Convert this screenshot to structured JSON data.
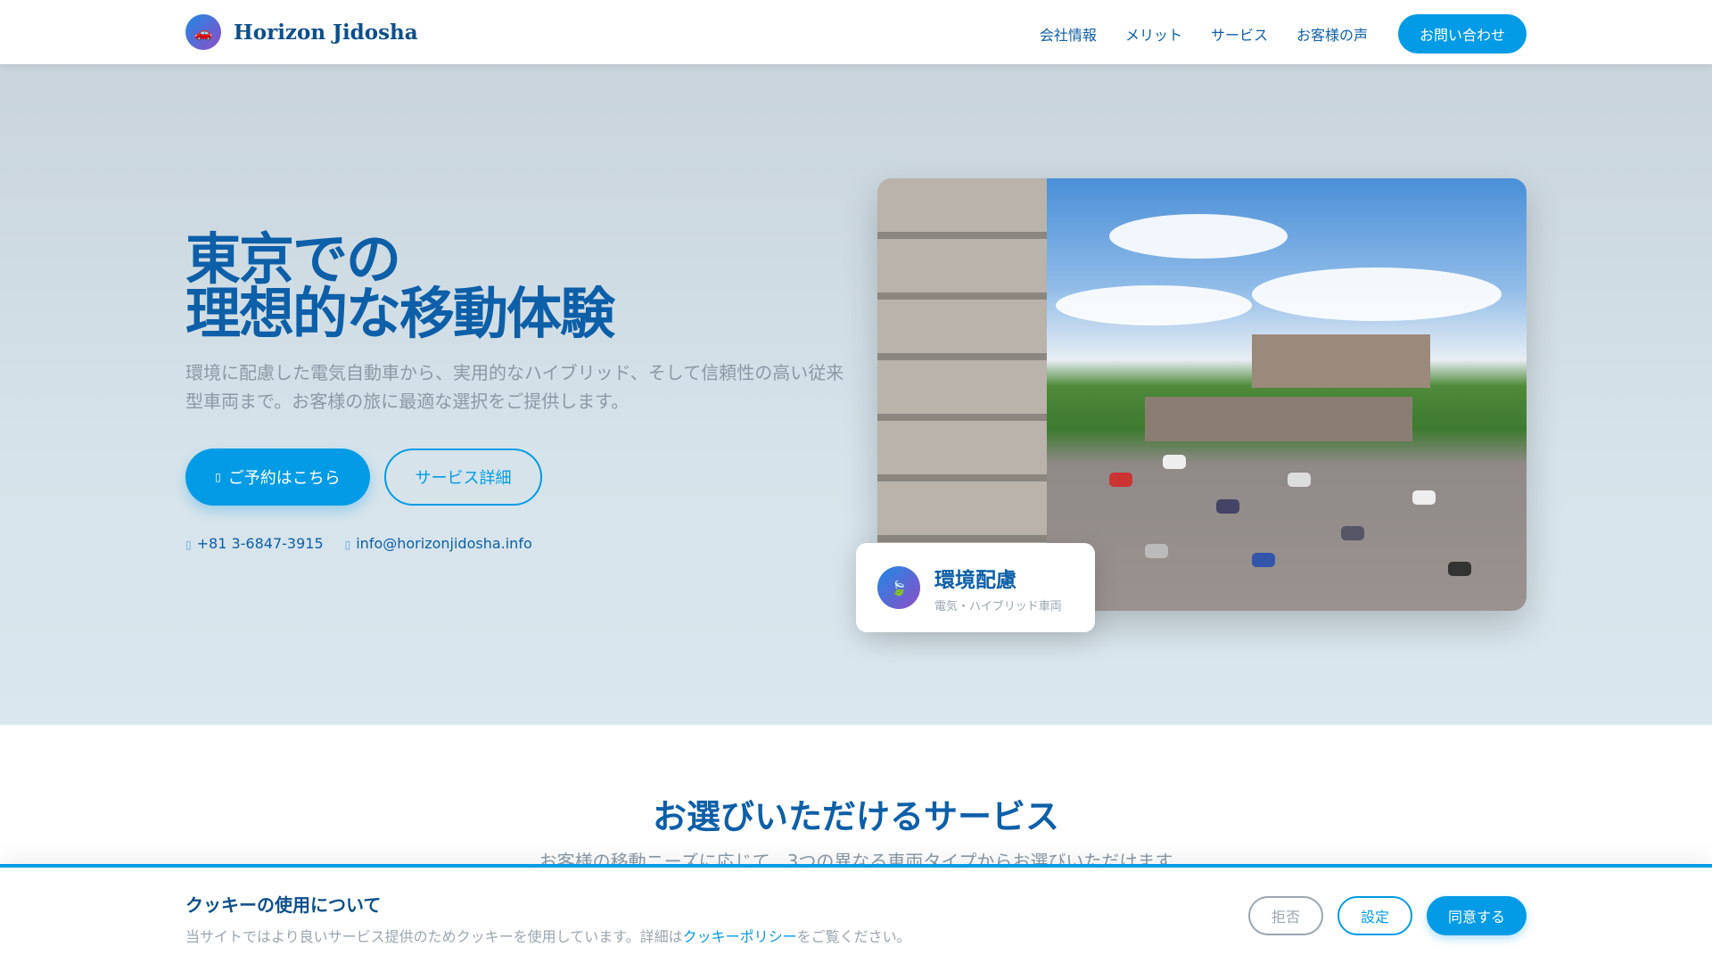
{
  "header": {
    "brand": "Horizon Jidosha",
    "nav": [
      "会社情報",
      "メリット",
      "サービス",
      "お客様の声"
    ],
    "contact_button": "お問い合わせ",
    "icon": "car-icon"
  },
  "hero": {
    "title_line1": "東京での",
    "title_line2": "理想的な移動体験",
    "lead": "環境に配慮した電気自動車から、実用的なハイブリッド、そして信頼性の高い従来型車両まで。お客様の旅に最適な選択をご提供します。",
    "primary_button": "ご予約はこちら",
    "secondary_button": "サービス詳細",
    "phone": "+81 3-6847-3915",
    "email": "info@horizonjidosha.info",
    "card": {
      "title": "環境配慮",
      "subtitle": "電気・ハイブリッド車両",
      "icon": "leaf-icon"
    }
  },
  "services": {
    "title": "お選びいただけるサービス",
    "subtitle": "お客様の移動ニーズに応じて、3つの異なる車両タイプからお選びいただけます"
  },
  "cookie": {
    "title": "クッキーの使用について",
    "text_before": "当サイトではより良いサービス提供のためクッキーを使用しています。詳細は",
    "link": "クッキーポリシー",
    "text_after": "をご覧ください。",
    "reject": "拒否",
    "settings": "設定",
    "accept": "同意する"
  },
  "colors": {
    "primary": "#039be5",
    "navy": "#0d5fa8"
  }
}
